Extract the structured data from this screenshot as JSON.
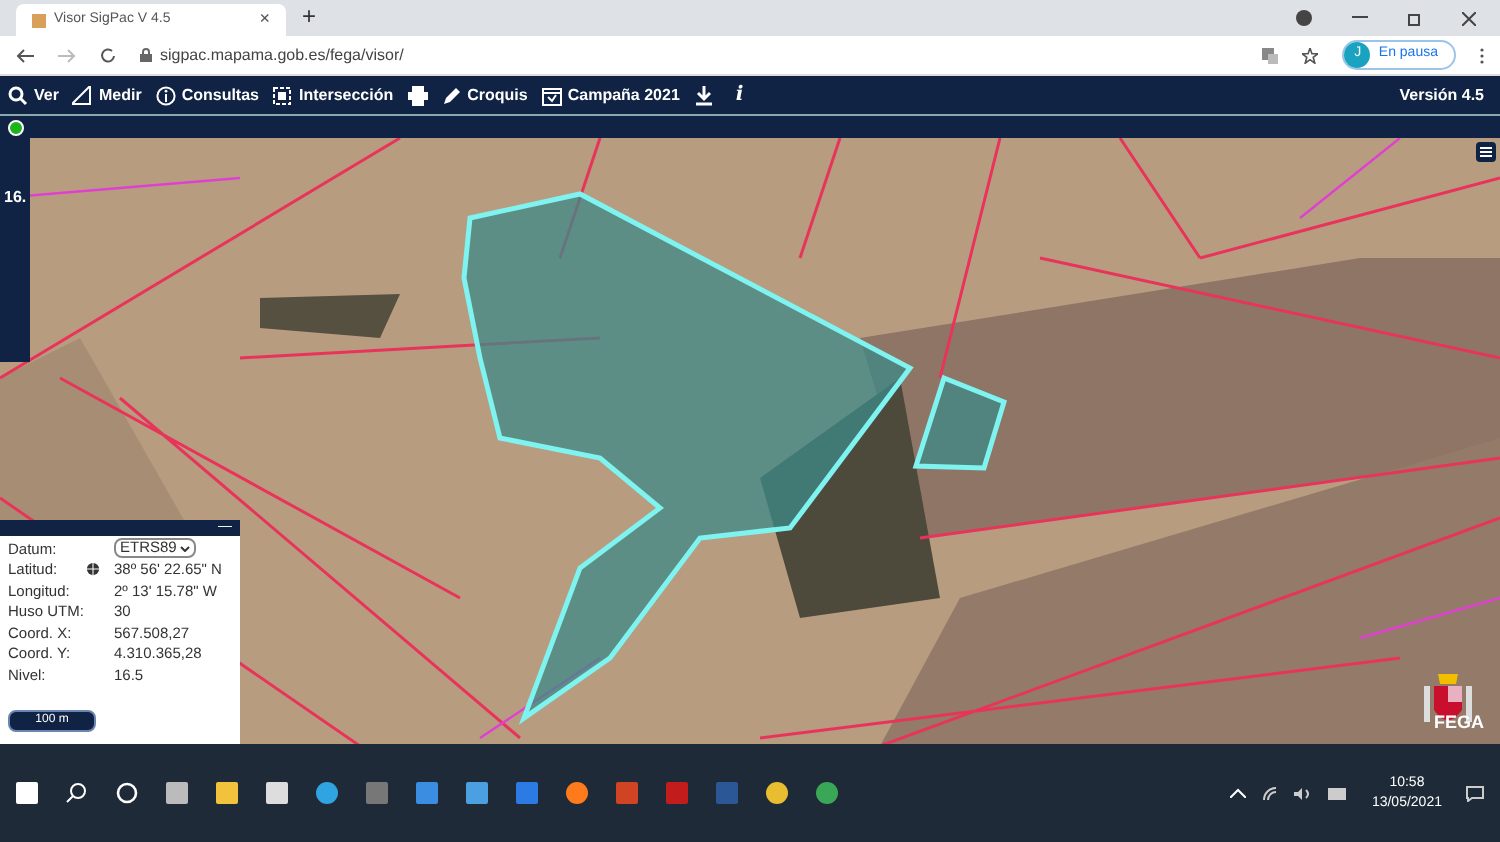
{
  "browser": {
    "tab_title": "Visor SigPac V 4.5",
    "tab_close": "×",
    "new_tab": "+",
    "url": "sigpac.mapama.gob.es/fega/visor/",
    "profile_initial": "J",
    "profile_status": "En pausa"
  },
  "toolbar": {
    "items": [
      {
        "kind": "search",
        "label": "Ver"
      },
      {
        "kind": "measure",
        "label": "Medir"
      },
      {
        "kind": "info",
        "label": "Consultas"
      },
      {
        "kind": "intersect",
        "label": "Intersección"
      },
      {
        "kind": "print"
      },
      {
        "kind": "pencil",
        "label": "Croquis"
      },
      {
        "kind": "calendar",
        "label": "Campaña 2021"
      },
      {
        "kind": "download"
      },
      {
        "kind": "about",
        "label": "i"
      }
    ],
    "version": "Versión 4.5"
  },
  "map": {
    "zoom_level": "16.",
    "attribution": "FEGA"
  },
  "coordinates_panel": {
    "minimize": "—",
    "rows": [
      {
        "label": "Datum:",
        "value": "ETRS89",
        "kind": "select"
      },
      {
        "label": "Latitud:",
        "value": "38º 56' 22.65\" N",
        "kind": "text"
      },
      {
        "label": "Longitud:",
        "value": "2º 13' 15.78\" W",
        "kind": "text"
      },
      {
        "label": "Huso UTM:",
        "value": "30",
        "kind": "text"
      },
      {
        "label": "Coord. X:",
        "value": "567.508,27",
        "kind": "text"
      },
      {
        "label": "Coord. Y:",
        "value": "4.310.365,28",
        "kind": "text"
      },
      {
        "label": "Nivel:",
        "value": "16.5",
        "kind": "text"
      }
    ],
    "scale": "100 m"
  },
  "taskbar": {
    "time": "10:58",
    "date": "13/05/2021"
  }
}
